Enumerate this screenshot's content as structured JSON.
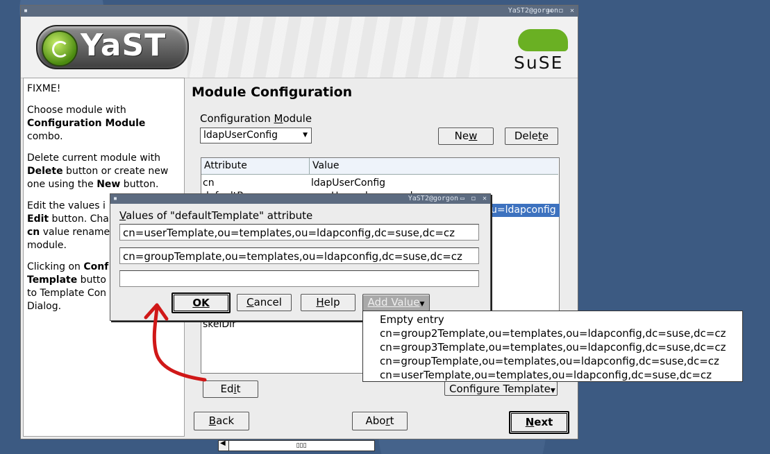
{
  "main_window": {
    "title": "YaST2@gorgon",
    "controls": "▭ ◻ ✕",
    "logo_text": "YaST",
    "vendor_text": "SuSE"
  },
  "help": {
    "p1": "FIXME!",
    "p2a": "Choose module with ",
    "p2b": "Configuration Module",
    "p2c": " combo.",
    "p3a": "Delete current module with ",
    "p3b": "Delete",
    "p3c": " button or create new one using the ",
    "p3d": "New",
    "p3e": " button.",
    "p4a": "Edit the values i",
    "p4b": "Edit",
    "p4c": " button. Cha",
    "p4d": "cn",
    "p4e": " value rename",
    "p4f": "module.",
    "p5a": "Clicking on ",
    "p5b": "Conf",
    "p5c": "Template",
    "p5d": " butto",
    "p5e": "to Template Con",
    "p5f": "Dialog."
  },
  "content": {
    "heading": "Module Configuration",
    "config_module_label_pre": "Configuration ",
    "config_module_label_u": "M",
    "config_module_label_post": "odule",
    "config_module_value": "ldapUserConfig",
    "new_pre": "Ne",
    "new_u": "w",
    "delete_pre": "Dele",
    "delete_u": "t",
    "delete_post": "e",
    "columns": [
      "Attribute",
      "Value"
    ],
    "rows": [
      {
        "attr": "cn",
        "value": "ldapUserConfig"
      },
      {
        "attr": "defaultBase",
        "value": "ou=Users,dc=suse,dc=cz"
      }
    ],
    "selected_row_value_tail": "u=ldapconfig",
    "hidden_row_attr": "skelDir",
    "scroll_thumb": "▯▯▯",
    "edit_pre": "Ed",
    "edit_u": "i",
    "edit_post": "t",
    "configure_template": "Configure Template",
    "back_u": "B",
    "back_post": "ack",
    "abort_pre": "Abo",
    "abort_u": "r",
    "abort_post": "t",
    "next_u": "N",
    "next_post": "ext"
  },
  "dialog": {
    "title": "YaST2@gorgon",
    "label_u": "V",
    "label_post": "alues of \"defaultTemplate\" attribute",
    "values": [
      "cn=userTemplate,ou=templates,ou=ldapconfig,dc=suse,dc=cz",
      "cn=groupTemplate,ou=templates,ou=ldapconfig,dc=suse,dc=cz",
      ""
    ],
    "ok": "OK",
    "cancel_u": "C",
    "cancel_post": "ancel",
    "help_u": "H",
    "help_post": "elp",
    "add_value": "Add Value"
  },
  "popup": {
    "items": [
      "Empty entry",
      "cn=group2Template,ou=templates,ou=ldapconfig,dc=suse,dc=cz",
      "cn=group3Template,ou=templates,ou=ldapconfig,dc=suse,dc=cz",
      "cn=groupTemplate,ou=templates,ou=ldapconfig,dc=suse,dc=cz",
      "cn=userTemplate,ou=templates,ou=ldapconfig,dc=suse,dc=cz"
    ]
  },
  "colors": {
    "selection": "#3d72bf",
    "annotation_arrow": "#d01818",
    "suse_green": "#6ab023"
  }
}
